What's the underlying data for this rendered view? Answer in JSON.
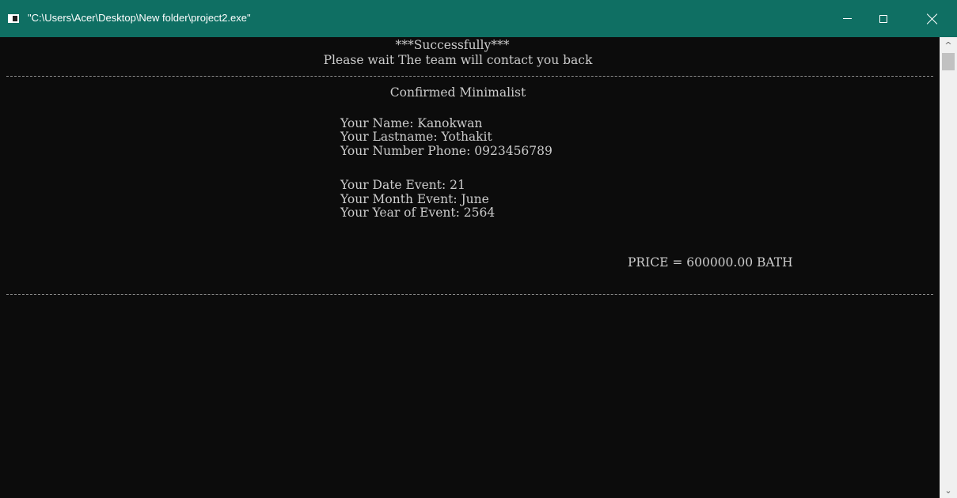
{
  "window": {
    "title": "\"C:\\Users\\Acer\\Desktop\\New folder\\project2.exe\"",
    "minimize_label": "—",
    "maximize_label": "□",
    "close_label": "×"
  },
  "console": {
    "success": "***Successfully***",
    "wait": "Please wait The team will contact you back",
    "confirmed": "Confirmed Minimalist",
    "name": "Your Name: Kanokwan",
    "lastname": "Your Lastname: Yothakit",
    "phone": "Your Number Phone: 0923456789",
    "date": "Your Date Event: 21",
    "month": "Your Month Event: June",
    "year": "Your Year of Event: 2564",
    "price": "PRICE = 600000.00 BATH"
  },
  "colors": {
    "titlebar": "#0f6f63",
    "console_bg": "#0c0c0c",
    "console_text": "#cccccc",
    "scrollbar": "#f0f0f0"
  }
}
